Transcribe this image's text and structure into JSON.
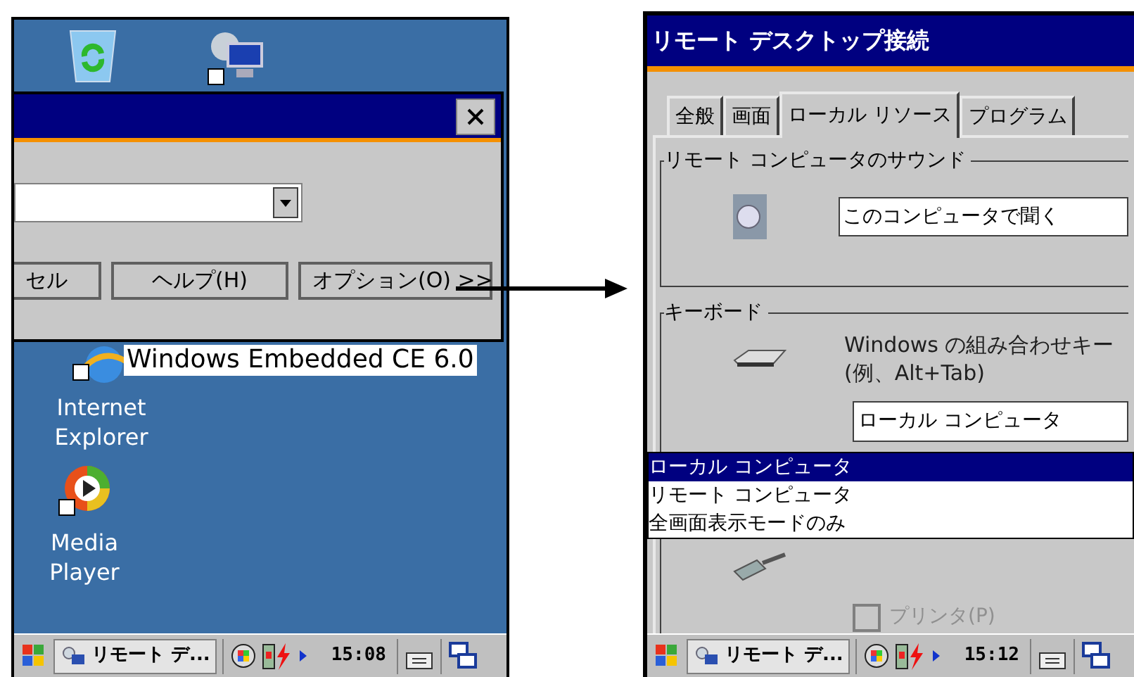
{
  "left_screen": {
    "dialog": {
      "buttons": [
        "セル",
        "ヘルプ(H)",
        "オプション(O) >>"
      ]
    },
    "tooltip": "Windows Embedded CE 6.0",
    "desktop_icons": [
      {
        "kind": "browser",
        "label": "Internet Explorer"
      },
      {
        "kind": "media",
        "label": "Media Player"
      }
    ],
    "taskbar": {
      "task": "リモート デ...",
      "time": "15:08"
    }
  },
  "right_screen": {
    "title": "リモート デスクトップ接続",
    "tabs": [
      {
        "label": "全般",
        "selected": false
      },
      {
        "label": "画面",
        "selected": false
      },
      {
        "label": "ローカル リソース",
        "selected": true
      },
      {
        "label": "プログラム",
        "selected": false
      }
    ],
    "sound_group": {
      "title": "リモート コンピュータのサウンド",
      "value": "このコンピュータで聞く"
    },
    "keyboard_group": {
      "title": "キーボード",
      "description": "Windows の組み合わせキー",
      "example": "(例、Alt+Tab)",
      "value": "ローカル コンピュータ",
      "options": [
        {
          "label": "ローカル コンピュータ",
          "selected": true
        },
        {
          "label": "リモート コンピュータ",
          "selected": false
        },
        {
          "label": "全画面表示モードのみ",
          "selected": false
        }
      ]
    },
    "printer_checkbox": {
      "label": "プリンタ(P)",
      "checked": false,
      "disabled": true
    },
    "taskbar": {
      "task": "リモート デ...",
      "time": "15:12"
    }
  }
}
